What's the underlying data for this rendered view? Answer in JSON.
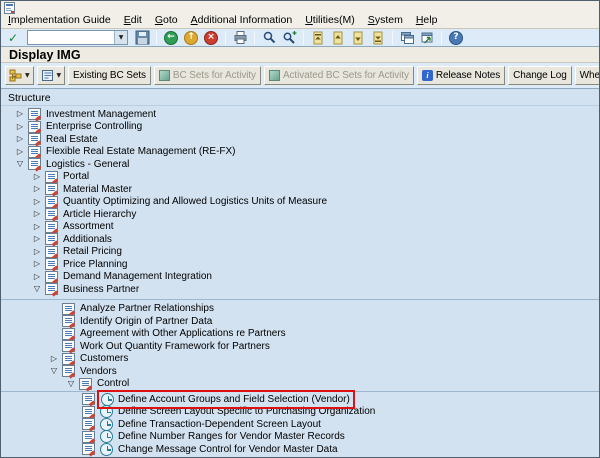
{
  "window": {
    "page_title": "Display IMG"
  },
  "menubar": {
    "items": [
      {
        "label": "Implementation Guide"
      },
      {
        "label": "Edit"
      },
      {
        "label": "Goto"
      },
      {
        "label": "Additional Information"
      },
      {
        "label": "Utilities(M)"
      },
      {
        "label": "System"
      },
      {
        "label": "Help"
      }
    ]
  },
  "toolbar": {
    "command_field": {
      "value": ""
    },
    "icon_names": [
      "enter",
      "save",
      "back",
      "exit",
      "cancel",
      "print",
      "find",
      "find-next",
      "first-page",
      "previous-page",
      "next-page",
      "last-page",
      "new-session",
      "create-shortcut",
      "help"
    ]
  },
  "app_toolbar": {
    "icon_buttons": [
      "hierarchy-dropdown",
      "position-dropdown"
    ],
    "buttons": [
      {
        "label": "Existing BC Sets",
        "enabled": true
      },
      {
        "label": "BC Sets for Activity",
        "enabled": false,
        "icon": "bc-set"
      },
      {
        "label": "Activated BC Sets for Activity",
        "enabled": false,
        "icon": "bc-set"
      },
      {
        "label": "Release Notes",
        "enabled": true,
        "icon": "info"
      },
      {
        "label": "Change Log",
        "enabled": true
      },
      {
        "label": "Where Else Used",
        "enabled": true
      }
    ]
  },
  "structure": {
    "header": "Structure"
  },
  "icons": {
    "collapsed": "▷",
    "expanded": "▽",
    "dropdown": "▼",
    "check": "✓",
    "back_arrow": "←",
    "up_arrow": "↑",
    "cancel_x": "×",
    "help": "?",
    "info": "i"
  },
  "colors": {
    "highlight_box": "#dd1111",
    "content_bg": "#d3e2f1",
    "toolbar_bg": "#dcebf7",
    "chrome_bg": "#f1efe8"
  },
  "tree": {
    "items": [
      {
        "level": 0,
        "expander": "collapsed",
        "activity": false,
        "label": "Investment Management"
      },
      {
        "level": 0,
        "expander": "collapsed",
        "activity": false,
        "label": "Enterprise Controlling"
      },
      {
        "level": 0,
        "expander": "collapsed",
        "activity": false,
        "label": "Real Estate"
      },
      {
        "level": 0,
        "expander": "collapsed",
        "activity": false,
        "label": "Flexible Real Estate Management (RE-FX)"
      },
      {
        "level": 0,
        "expander": "expanded",
        "activity": false,
        "label": "Logistics - General"
      },
      {
        "level": 1,
        "expander": "collapsed",
        "activity": false,
        "label": "Portal"
      },
      {
        "level": 1,
        "expander": "collapsed",
        "activity": false,
        "label": "Material Master"
      },
      {
        "level": 1,
        "expander": "collapsed",
        "activity": false,
        "label": "Quantity Optimizing and Allowed Logistics Units of Measure"
      },
      {
        "level": 1,
        "expander": "collapsed",
        "activity": false,
        "label": "Article Hierarchy"
      },
      {
        "level": 1,
        "expander": "collapsed",
        "activity": false,
        "label": "Assortment"
      },
      {
        "level": 1,
        "expander": "collapsed",
        "activity": false,
        "label": "Additionals"
      },
      {
        "level": 1,
        "expander": "collapsed",
        "activity": false,
        "label": "Retail Pricing"
      },
      {
        "level": 1,
        "expander": "collapsed",
        "activity": false,
        "label": "Price Planning"
      },
      {
        "level": 1,
        "expander": "collapsed",
        "activity": false,
        "label": "Demand Management Integration"
      },
      {
        "level": 1,
        "expander": "expanded",
        "activity": false,
        "label": "Business Partner"
      },
      {
        "level": 2,
        "expander": "none",
        "activity": false,
        "label": "Analyze Partner Relationships"
      },
      {
        "level": 2,
        "expander": "none",
        "activity": false,
        "label": "Identify Origin of Partner Data"
      },
      {
        "level": 2,
        "expander": "none",
        "activity": false,
        "label": "Agreement with Other Applications re Partners"
      },
      {
        "level": 2,
        "expander": "none",
        "activity": false,
        "label": "Work Out Quantity Framework for Partners"
      },
      {
        "level": 2,
        "expander": "collapsed",
        "activity": false,
        "label": "Customers"
      },
      {
        "level": 2,
        "expander": "expanded",
        "activity": false,
        "label": "Vendors"
      },
      {
        "level": 3,
        "expander": "expanded",
        "activity": false,
        "label": "Control"
      },
      {
        "level": 4,
        "expander": "none",
        "activity": true,
        "highlighted": true,
        "label": "Define Account Groups and Field Selection (Vendor)"
      },
      {
        "level": 4,
        "expander": "none",
        "activity": true,
        "label": "Define Screen Layout Specific to Purchasing Organization"
      },
      {
        "level": 4,
        "expander": "none",
        "activity": true,
        "label": "Define Transaction-Dependent Screen Layout"
      },
      {
        "level": 4,
        "expander": "none",
        "activity": true,
        "label": "Define Number Ranges for Vendor Master Records"
      },
      {
        "level": 4,
        "expander": "none",
        "activity": true,
        "label": "Change Message Control for Vendor Master Data"
      }
    ]
  }
}
